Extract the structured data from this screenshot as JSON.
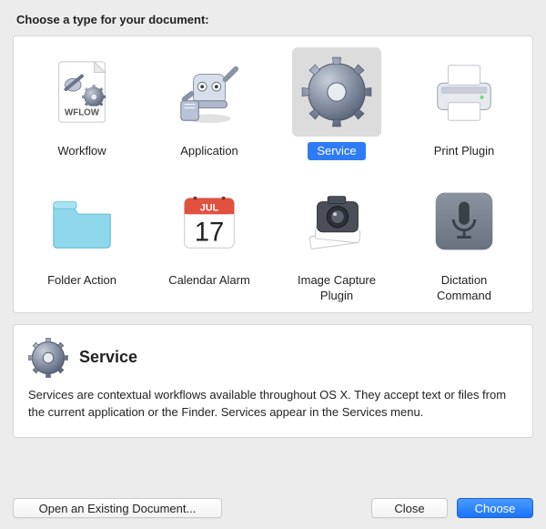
{
  "prompt": "Choose a type for your document:",
  "types": [
    {
      "id": "workflow",
      "label": "Workflow",
      "icon": "wflow-doc-icon",
      "selected": false
    },
    {
      "id": "application",
      "label": "Application",
      "icon": "automator-app-icon",
      "selected": false
    },
    {
      "id": "service",
      "label": "Service",
      "icon": "gear-icon",
      "selected": true
    },
    {
      "id": "print-plugin",
      "label": "Print Plugin",
      "icon": "printer-icon",
      "selected": false
    },
    {
      "id": "folder-action",
      "label": "Folder Action",
      "icon": "folder-icon",
      "selected": false
    },
    {
      "id": "calendar-alarm",
      "label": "Calendar Alarm",
      "icon": "calendar-icon",
      "selected": false
    },
    {
      "id": "image-capture",
      "label": "Image Capture\nPlugin",
      "icon": "camera-icon",
      "selected": false
    },
    {
      "id": "dictation",
      "label": "Dictation\nCommand",
      "icon": "microphone-icon",
      "selected": false
    }
  ],
  "detail": {
    "icon": "gear-icon",
    "title": "Service",
    "body": "Services are contextual workflows available throughout OS X. They accept text or files from the current application or the Finder. Services appear in the Services menu."
  },
  "calendar": {
    "month": "JUL",
    "day": "17"
  },
  "wflow_badge": "WFLOW",
  "buttons": {
    "open_existing": "Open an Existing Document...",
    "close": "Close",
    "choose": "Choose"
  }
}
